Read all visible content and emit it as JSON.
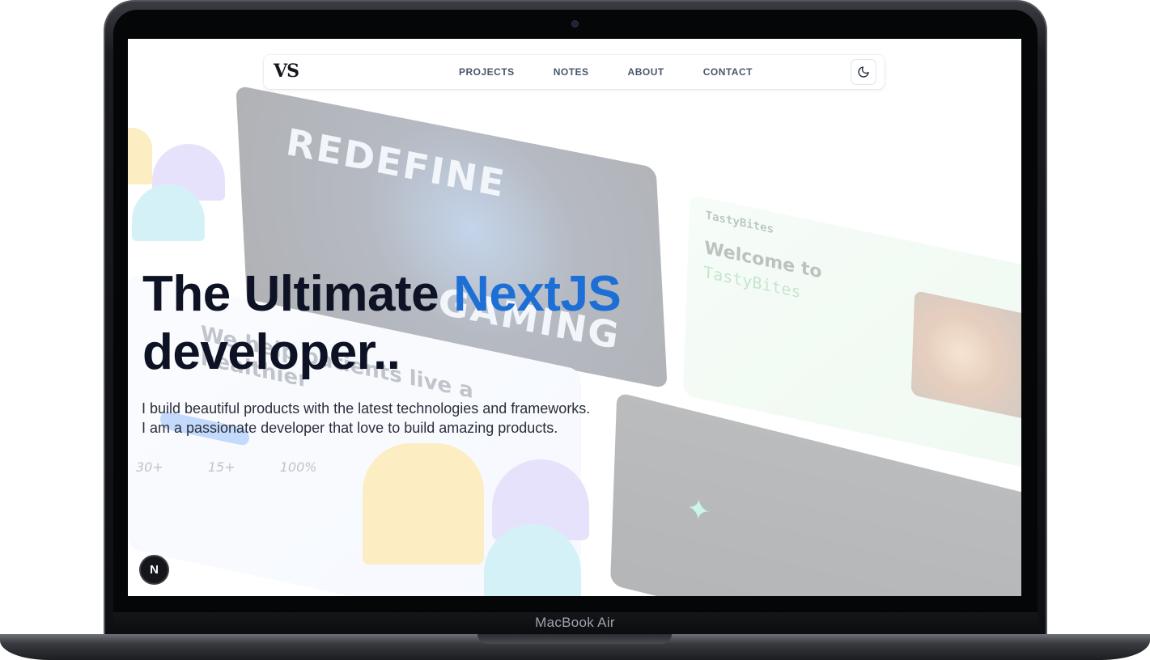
{
  "device": {
    "label": "MacBook Air"
  },
  "nav": {
    "logo": "VS",
    "links": [
      "PROJECTS",
      "NOTES",
      "ABOUT",
      "CONTACT"
    ],
    "theme_toggle_icon": "moon-icon"
  },
  "hero": {
    "title_part1": "The Ultimate",
    "title_accent": "NextJS",
    "title_part2": "developer..",
    "subtitle_line1": "I build beautiful products with the latest technologies and frameworks.",
    "subtitle_line2": "I am a passionate developer that love to build amazing products.",
    "accent_color": "#1d6fd6"
  },
  "background_collage": {
    "gaming_card_text": "REDEFINE",
    "gaming_card_text2": "GAMING",
    "tasty_card_brand": "TastyBites",
    "tasty_card_heading": "Welcome to",
    "tasty_card_brand_large": "TastyBites",
    "medical_card_text": "We help patients live a healthier",
    "stats": [
      "30+",
      "15+",
      "100%"
    ]
  },
  "badge": {
    "label": "N"
  }
}
